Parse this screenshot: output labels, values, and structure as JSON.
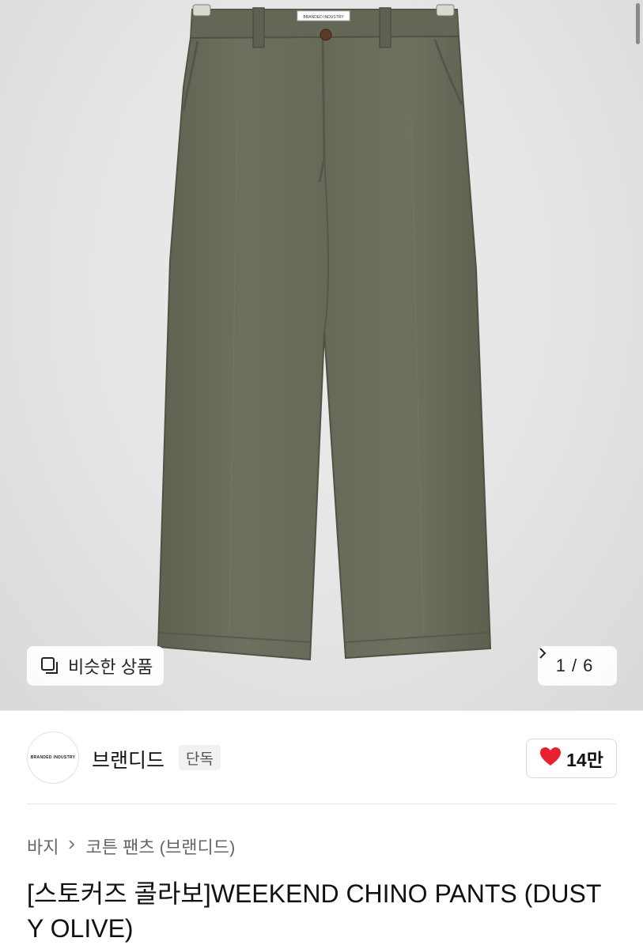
{
  "image": {
    "brand_label_text": "BRANDED INDUSTRY",
    "similar_button_label": "비슷한 상품",
    "pager_current": "1",
    "pager_separator": "/",
    "pager_total": "6",
    "colors": {
      "pants": "#6a6d5b",
      "background": "#e6e6e6"
    }
  },
  "seller": {
    "avatar_text": "BRANDED INDUSTRY",
    "name": "브랜디드",
    "badge": "단독",
    "like_count": "14만",
    "heart_color": "#e8212e"
  },
  "breadcrumb": {
    "category": "바지",
    "subcategory": "코튼 팬츠 (브랜디드)"
  },
  "product": {
    "title": "[스토커즈 콜라보]WEEKEND CHINO PANTS (DUSTY OLIVE)"
  }
}
